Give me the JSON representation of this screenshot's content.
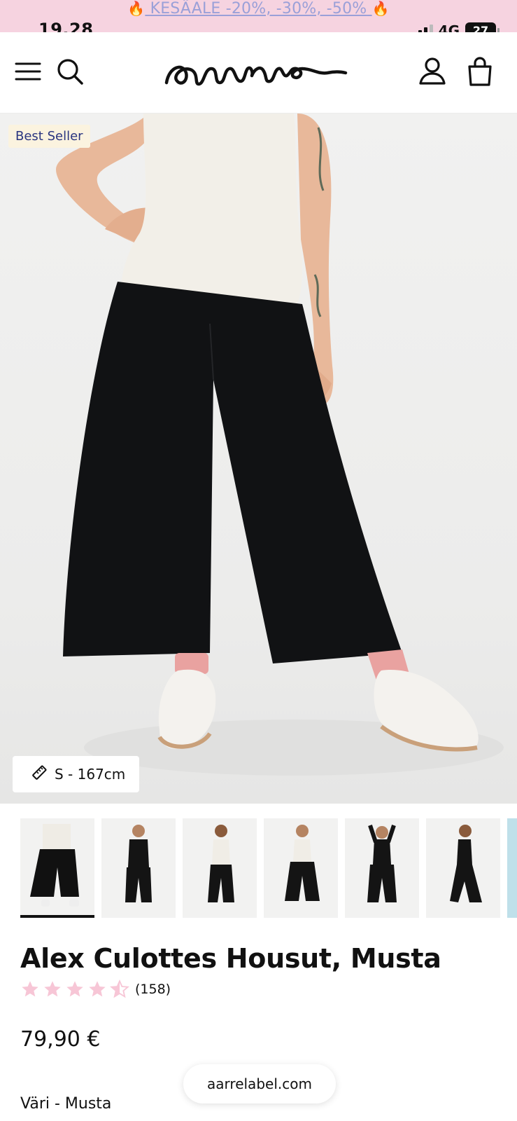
{
  "promo": {
    "text": "KESÄALE -20%, -30%, -50%",
    "flame_left": "🔥",
    "flame_right": "🔥"
  },
  "status_bar": {
    "time": "19.28",
    "network": "4G",
    "battery": "27"
  },
  "header": {
    "menu_icon": "hamburger-icon",
    "search_icon": "search-icon",
    "logo_name": "aarre",
    "account_icon": "user-icon",
    "cart_icon": "shopping-bag-icon"
  },
  "hero": {
    "badge": "Best Seller",
    "size_chip": "S - 167cm",
    "size_icon": "ruler-icon"
  },
  "thumbnails": [
    {
      "name": "front-view",
      "active": true
    },
    {
      "name": "black-top-front"
    },
    {
      "name": "back-view"
    },
    {
      "name": "front-white-top"
    },
    {
      "name": "arms-up-pose"
    },
    {
      "name": "side-walking"
    }
  ],
  "product": {
    "title": "Alex Culottes Housut, Musta",
    "rating": 4.5,
    "review_count": "(158)",
    "price": "79,90 €",
    "color_label": "Väri - Musta"
  },
  "browser": {
    "url": "aarrelabel.com"
  },
  "colors": {
    "promo_bg": "#f6d3e0",
    "star": "#f7c6d6",
    "badge_bg": "#fbf3df",
    "badge_text": "#2a3580"
  }
}
